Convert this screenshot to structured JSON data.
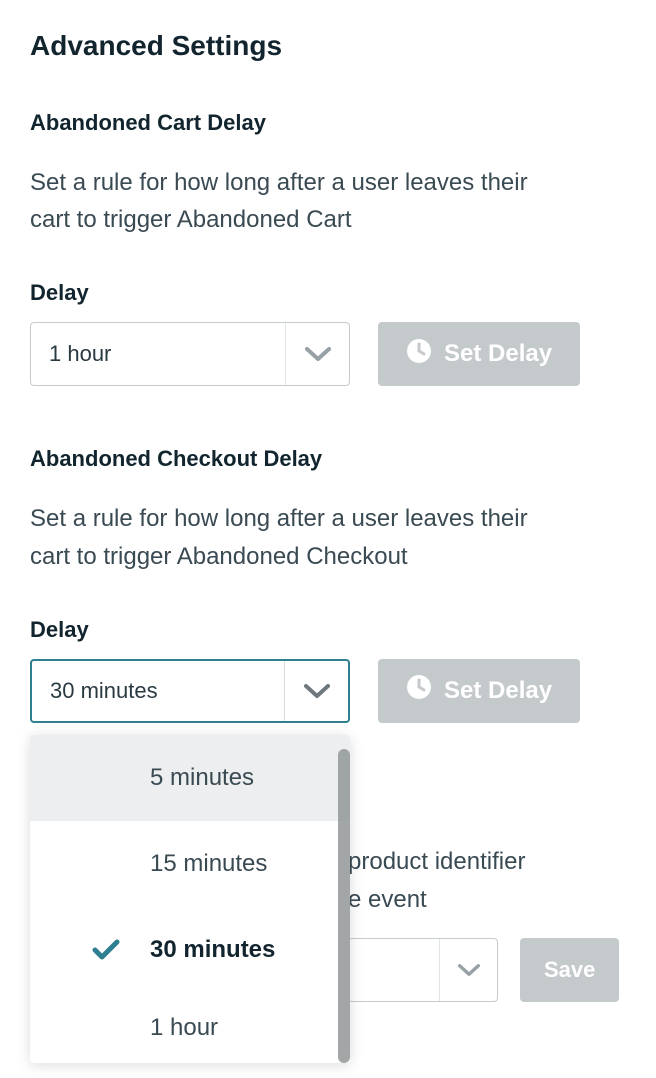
{
  "title": "Advanced Settings",
  "cartDelay": {
    "heading": "Abandoned Cart Delay",
    "description": "Set a rule for how long after a user leaves their cart to trigger Abandoned Cart",
    "fieldLabel": "Delay",
    "value": "1 hour",
    "buttonLabel": "Set Delay"
  },
  "checkoutDelay": {
    "heading": "Abandoned Checkout Delay",
    "description": "Set a rule for how long after a user leaves their cart to trigger Abandoned Checkout",
    "fieldLabel": "Delay",
    "value": "30 minutes",
    "buttonLabel": "Set Delay",
    "options": [
      "5 minutes",
      "15 minutes",
      "30 minutes",
      "1 hour"
    ],
    "selectedIndex": 2,
    "hoverIndex": 0
  },
  "identifier": {
    "partialText1": "product identifier",
    "partialText2": "e event",
    "value": "",
    "saveLabel": "Save"
  },
  "colors": {
    "accent": "#2e7f8f",
    "disabled": "#c4c9cb",
    "text": "#1a2a33"
  }
}
